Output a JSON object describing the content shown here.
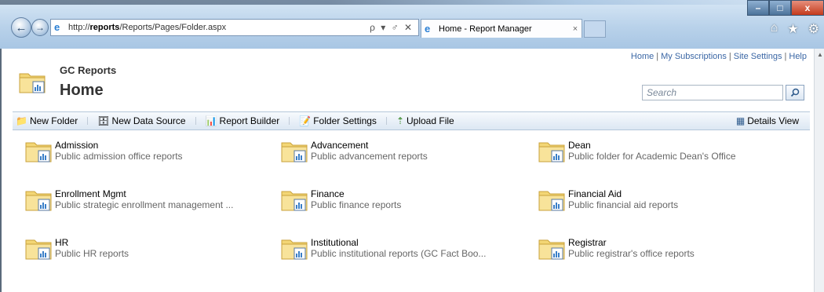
{
  "browser": {
    "address_prefix": "http://",
    "address_host": "reports",
    "address_path": "/Reports/Pages/Folder.aspx",
    "address_tools": "ρ ▾ ♂ ✕",
    "tab_label": "Home - Report Manager",
    "tab_close": "×",
    "win_min": "–",
    "win_max": "□",
    "win_close": "x"
  },
  "top_links": [
    "Home",
    "My Subscriptions",
    "Site Settings",
    "Help"
  ],
  "site_title": "GC Reports",
  "page_title": "Home",
  "search": {
    "placeholder": "Search"
  },
  "toolbar": {
    "new_folder": "New Folder",
    "new_data_source": "New Data Source",
    "report_builder": "Report Builder",
    "folder_settings": "Folder Settings",
    "upload_file": "Upload File",
    "details_view": "Details View"
  },
  "folders": [
    {
      "name": "Admission",
      "desc": "Public admission office reports"
    },
    {
      "name": "Advancement",
      "desc": "Public advancement reports"
    },
    {
      "name": "Dean",
      "desc": "Public folder for Academic Dean's Office"
    },
    {
      "name": "Enrollment Mgmt",
      "desc": "Public strategic enrollment management ..."
    },
    {
      "name": "Finance",
      "desc": "Public finance reports"
    },
    {
      "name": "Financial Aid",
      "desc": "Public financial aid reports"
    },
    {
      "name": "HR",
      "desc": "Public HR reports"
    },
    {
      "name": "Institutional",
      "desc": "Public institutional reports (GC Fact Boo..."
    },
    {
      "name": "Registrar",
      "desc": "Public registrar's office reports"
    }
  ]
}
